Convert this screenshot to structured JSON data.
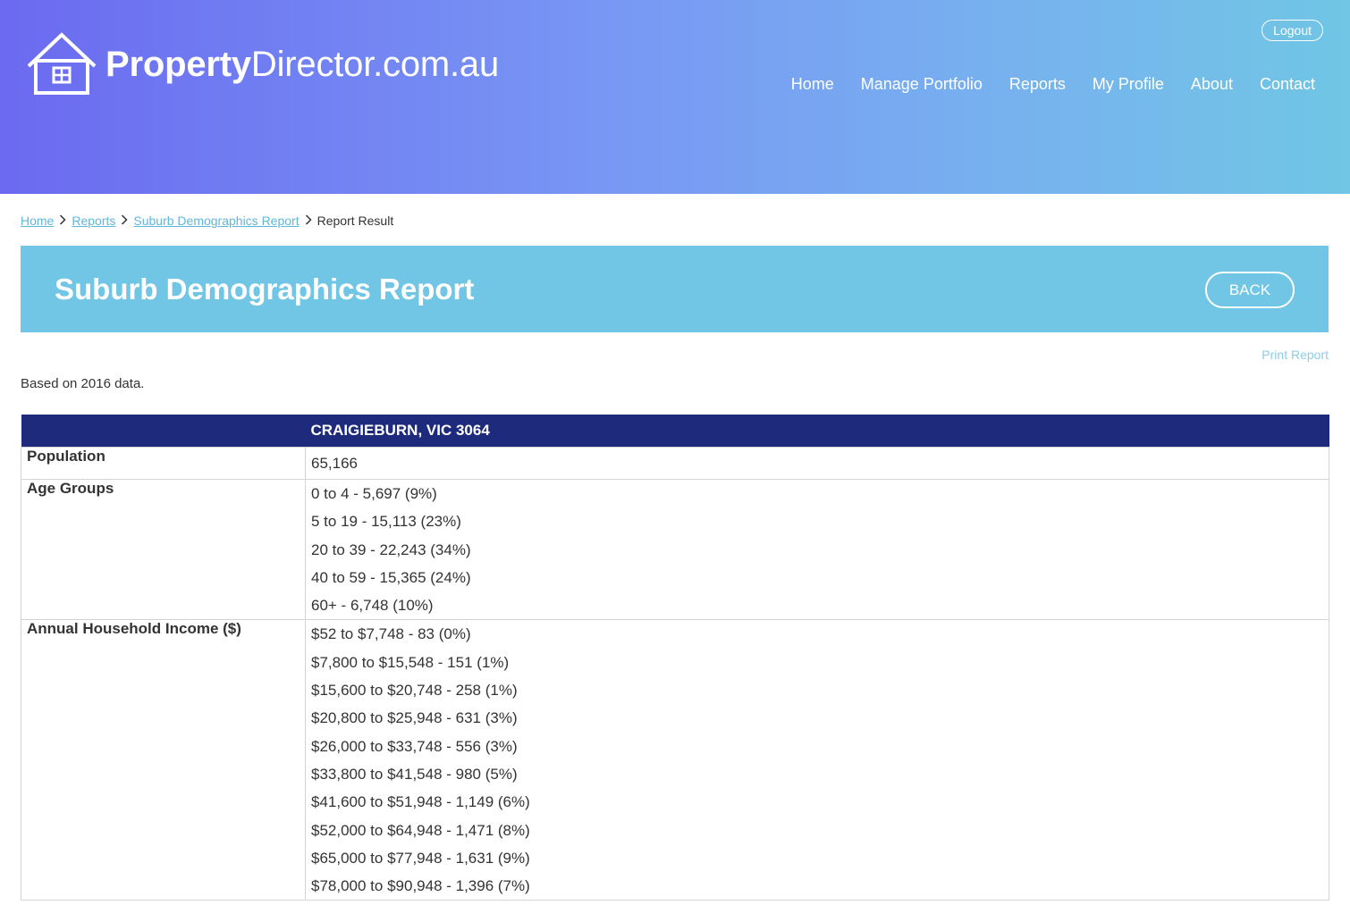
{
  "header": {
    "logo_bold": "Property",
    "logo_light": "Director.com.au",
    "logout": "Logout",
    "nav": [
      "Home",
      "Manage Portfolio",
      "Reports",
      "My Profile",
      "About",
      "Contact"
    ]
  },
  "breadcrumb": {
    "home": "Home",
    "reports": "Reports",
    "suburb": "Suburb Demographics Report",
    "current": "Report Result"
  },
  "banner": {
    "title": "Suburb Demographics Report",
    "back": "BACK"
  },
  "print_link": "Print Report",
  "based_on": "Based on 2016 data.",
  "table": {
    "column_header": "CRAIGIEBURN, VIC 3064",
    "population_label": "Population",
    "population_value": "65,166",
    "age_label": "Age Groups",
    "age_groups": [
      "0 to 4 - 5,697 (9%)",
      "5 to 19 - 15,113 (23%)",
      "20 to 39 - 22,243 (34%)",
      "40 to 59 - 15,365 (24%)",
      "60+ - 6,748 (10%)"
    ],
    "income_label": "Annual Household Income ($)",
    "income_groups": [
      "$52 to $7,748 - 83 (0%)",
      "$7,800 to $15,548 - 151 (1%)",
      "$15,600 to $20,748 - 258 (1%)",
      "$20,800 to $25,948 - 631 (3%)",
      "$26,000 to $33,748 - 556 (3%)",
      "$33,800 to $41,548 - 980 (5%)",
      "$41,600 to $51,948 - 1,149 (6%)",
      "$52,000 to $64,948 - 1,471 (8%)",
      "$65,000 to $77,948 - 1,631 (9%)",
      "$78,000 to $90,948 - 1,396 (7%)"
    ]
  },
  "colors": {
    "header_gradient_start": "#6b6af0",
    "header_gradient_end": "#70c6e4",
    "banner": "#70c6e4",
    "table_header": "#1e2b7c",
    "link": "#5fb7d8"
  }
}
